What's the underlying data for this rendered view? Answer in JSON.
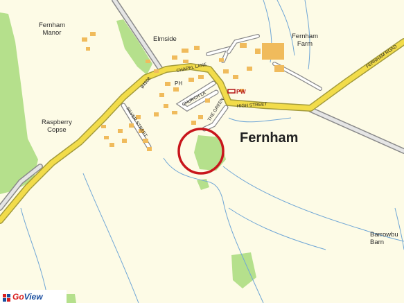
{
  "map": {
    "colors": {
      "background": "#fdfbe6",
      "main_road": "#f2dc4a",
      "road_casing": "#a39b3c",
      "minor_road": "#ffffff",
      "minor_road_casing": "#8a8a8a",
      "woodland": "#b5e08c",
      "water": "#6fa6d6",
      "building": "#f0bb5c",
      "marker": "#c8161c"
    },
    "places": {
      "fernham_manor": "Fernham\nManor",
      "elmside": "Elmside",
      "fernham_farm": "Fernham\nFarm",
      "raspberry_copse": "Raspberry\nCopse",
      "fernham": "Fernham",
      "barrowbush_barn": "Barrowbu\nBarn"
    },
    "poi": {
      "pw": "PW",
      "ph": "PH"
    },
    "roads": {
      "road_number": "B4508",
      "chapel_lane": "CHAPEL LANE",
      "church_lane": "CHURCH LA",
      "high_street": "HIGH STREET",
      "fernham_road": "FERNHAM ROAD",
      "silver_street": "SILVER STREET",
      "the_green": "THE GREEN"
    },
    "brand": {
      "name_part1": "Go",
      "name_part2": "View"
    },
    "marker_icon": "red-circle-marker"
  }
}
